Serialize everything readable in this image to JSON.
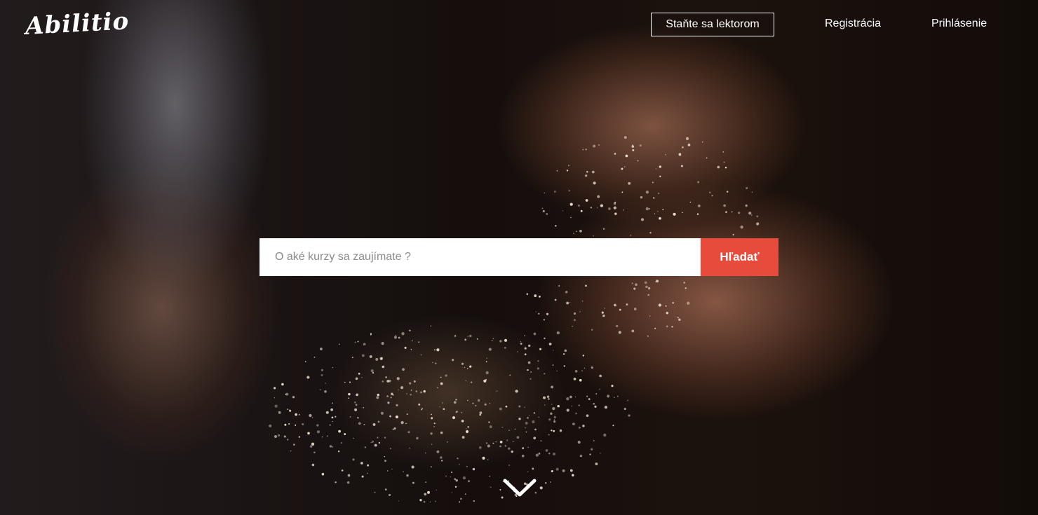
{
  "brand": {
    "logo_text": "Abilitio"
  },
  "nav": {
    "cta_label": "Staňte sa lektorom",
    "register_label": "Registrácia",
    "login_label": "Prihlásenie"
  },
  "search": {
    "placeholder": "O aké kurzy sa zaujímate ?",
    "value": "",
    "button_label": "Hľadať"
  },
  "colors": {
    "accent": "#e74b3c",
    "text": "#ffffff"
  },
  "icons": {
    "scroll": "chevron-down-icon"
  }
}
